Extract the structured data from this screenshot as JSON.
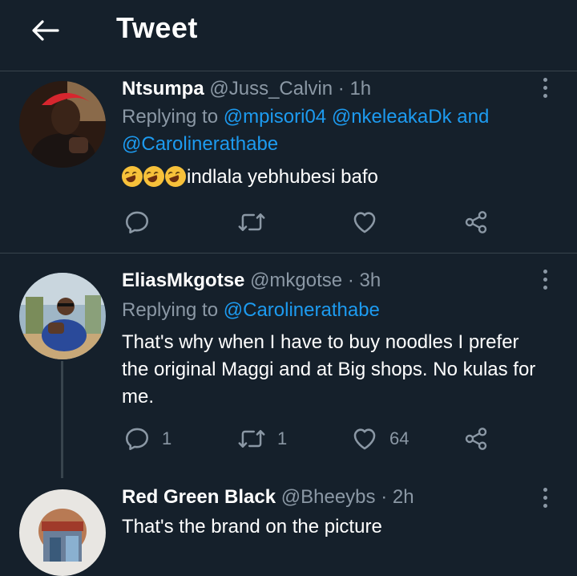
{
  "header": {
    "title": "Tweet"
  },
  "tweets": [
    {
      "name": "Ntsumpa",
      "handle": "@Juss_Calvin",
      "sep": "·",
      "time": "1h",
      "replying_prefix": "Replying to",
      "mentions": [
        "@mpisori04",
        "@nkeleakaDk",
        "and",
        "@Carolinerathabe"
      ],
      "text": "indlala yebhubesi bafo",
      "emoji_count": 3,
      "reply_count": "",
      "retweet_count": "",
      "like_count": ""
    },
    {
      "name": "EliasMkgotse",
      "handle": "@mkgotse",
      "sep": "·",
      "time": "3h",
      "replying_prefix": "Replying to",
      "mentions": [
        "@Carolinerathabe"
      ],
      "text_lines": [
        "That's why when I have to buy noodles I prefer",
        "the original Maggi and at Big shops. No kulas for",
        "me."
      ],
      "reply_count": "1",
      "retweet_count": "1",
      "like_count": "64"
    },
    {
      "name": "Red Green Black",
      "handle": "@Bheeybs",
      "sep": "·",
      "time": "2h",
      "text": "That's the brand on the picture"
    }
  ],
  "icons": {
    "back": "arrow-left-icon",
    "more": "more-vertical-icon",
    "reply": "reply-icon",
    "retweet": "retweet-icon",
    "like": "heart-icon",
    "share": "share-icon"
  },
  "colors": {
    "background": "#15202b",
    "border": "#38444d",
    "secondary_text": "#8b98a5",
    "link": "#1d9bf0",
    "text": "#ffffff"
  }
}
